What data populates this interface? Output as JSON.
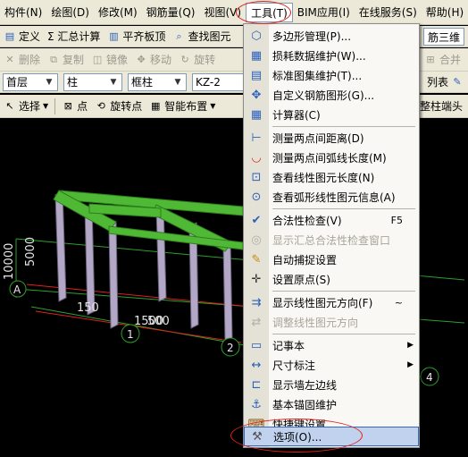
{
  "menubar": {
    "items": [
      {
        "label": "构件(N)"
      },
      {
        "label": "绘图(D)"
      },
      {
        "label": "修改(M)"
      },
      {
        "label": "钢筋量(Q)"
      },
      {
        "label": "视图(V)"
      },
      {
        "label": "工具(T)"
      },
      {
        "label": "BIM应用(I)"
      },
      {
        "label": "在线服务(S)"
      },
      {
        "label": "帮助(H)"
      }
    ]
  },
  "toolbar1": {
    "define": "定义",
    "sum_calc": "Σ 汇总计算",
    "flush": "平齐板顶",
    "find": "查找图元",
    "rebar3d": "筋三维"
  },
  "toolbar2": {
    "delete": "删除",
    "copy": "复制",
    "mirror": "镜像",
    "move": "移动",
    "rotate": "旋转",
    "merge": "合并"
  },
  "toolbar3": {
    "floor": "首层",
    "category": "柱",
    "type": "框柱",
    "name": "KZ-2",
    "list": "列表"
  },
  "toolbar4": {
    "select": "选择",
    "point": "点",
    "rotate_point": "旋转点",
    "smart_layout": "智能布置",
    "column_end": "整柱端头"
  },
  "canvas": {
    "dims": [
      "10000",
      "5000",
      "150",
      "1500",
      "500"
    ],
    "axis_labels": [
      "A",
      "1",
      "2",
      "4"
    ]
  },
  "dropdown": {
    "items": [
      {
        "label": "多边形管理(P)...",
        "icon": "polygon-icon",
        "glyph": "⬡"
      },
      {
        "label": "损耗数据维护(W)...",
        "icon": "loss-data-icon",
        "glyph": "▦"
      },
      {
        "label": "标准图集维护(T)...",
        "icon": "atlas-icon",
        "glyph": "▤"
      },
      {
        "label": "自定义钢筋图形(G)...",
        "icon": "custom-rebar-icon",
        "glyph": "✥"
      },
      {
        "label": "计算器(C)",
        "icon": "calculator-icon",
        "glyph": "▦"
      },
      {
        "label": "测量两点间距离(D)",
        "icon": "measure-distance-icon",
        "glyph": "⊢"
      },
      {
        "label": "测量两点间弧线长度(M)",
        "icon": "measure-arc-icon",
        "glyph": "◡"
      },
      {
        "label": "查看线性图元长度(N)",
        "icon": "view-length-icon",
        "glyph": "⊡"
      },
      {
        "label": "查看弧形线性图元信息(A)",
        "icon": "view-arc-icon",
        "glyph": "⊙"
      },
      {
        "label": "合法性检查(V)",
        "shortcut": "F5",
        "icon": "check-icon",
        "glyph": "✔"
      },
      {
        "label": "显示汇总合法性检查窗口",
        "disabled": true,
        "icon": "summary-check-icon",
        "glyph": "◎"
      },
      {
        "label": "自动捕捉设置",
        "icon": "auto-snap-icon",
        "glyph": "✎"
      },
      {
        "label": "设置原点(S)",
        "icon": "origin-icon",
        "glyph": "✛"
      },
      {
        "label": "显示线性图元方向(F)",
        "shortcut": "~",
        "icon": "show-direction-icon",
        "glyph": "⇉"
      },
      {
        "label": "调整线性图元方向",
        "disabled": true,
        "icon": "adjust-direction-icon",
        "glyph": "⇄"
      },
      {
        "label": "记事本",
        "submenu": true,
        "icon": "notepad-icon",
        "glyph": "▭"
      },
      {
        "label": "尺寸标注",
        "submenu": true,
        "icon": "dimension-icon",
        "glyph": "↔"
      },
      {
        "label": "显示墙左边线",
        "icon": "wall-left-icon",
        "glyph": "⊏"
      },
      {
        "label": "基本锚固维护",
        "icon": "anchor-icon",
        "glyph": "⚓"
      },
      {
        "label": "快捷键设置",
        "icon": "shortcut-icon",
        "glyph": "⌨"
      },
      {
        "label": "选项(O)...",
        "selected": true,
        "icon": "options-icon",
        "glyph": "⚒"
      }
    ]
  },
  "colors": {
    "beam": "#4fb936",
    "column": "#b3a7c6",
    "grid": "#2aa22a",
    "highlight": "#e0201c"
  }
}
